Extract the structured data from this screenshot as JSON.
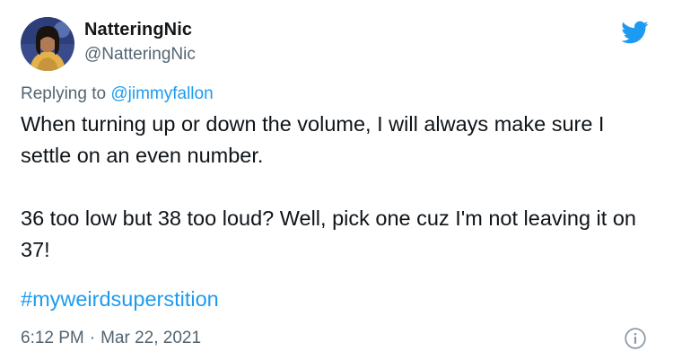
{
  "tweet": {
    "author": {
      "display_name": "NatteringNic",
      "handle": "@NatteringNic",
      "avatar_icon": "user-avatar-photo"
    },
    "replying_prefix": "Replying to",
    "replying_to": "@jimmyfallon",
    "paragraphs": [
      "When turning up or down the volume, I will always make sure I settle on an even number.",
      "36 too low but 38 too loud?  Well, pick one cuz I'm not leaving it on 37!"
    ],
    "hashtag": "#myweirdsuperstition",
    "time": "6:12 PM",
    "separator": "·",
    "date": "Mar 22, 2021"
  },
  "icons": {
    "brand": "twitter-bird-icon",
    "info": "info-icon"
  },
  "colors": {
    "brand_blue": "#1d9bf0",
    "text_primary": "#0f1419",
    "text_secondary": "#536471"
  }
}
